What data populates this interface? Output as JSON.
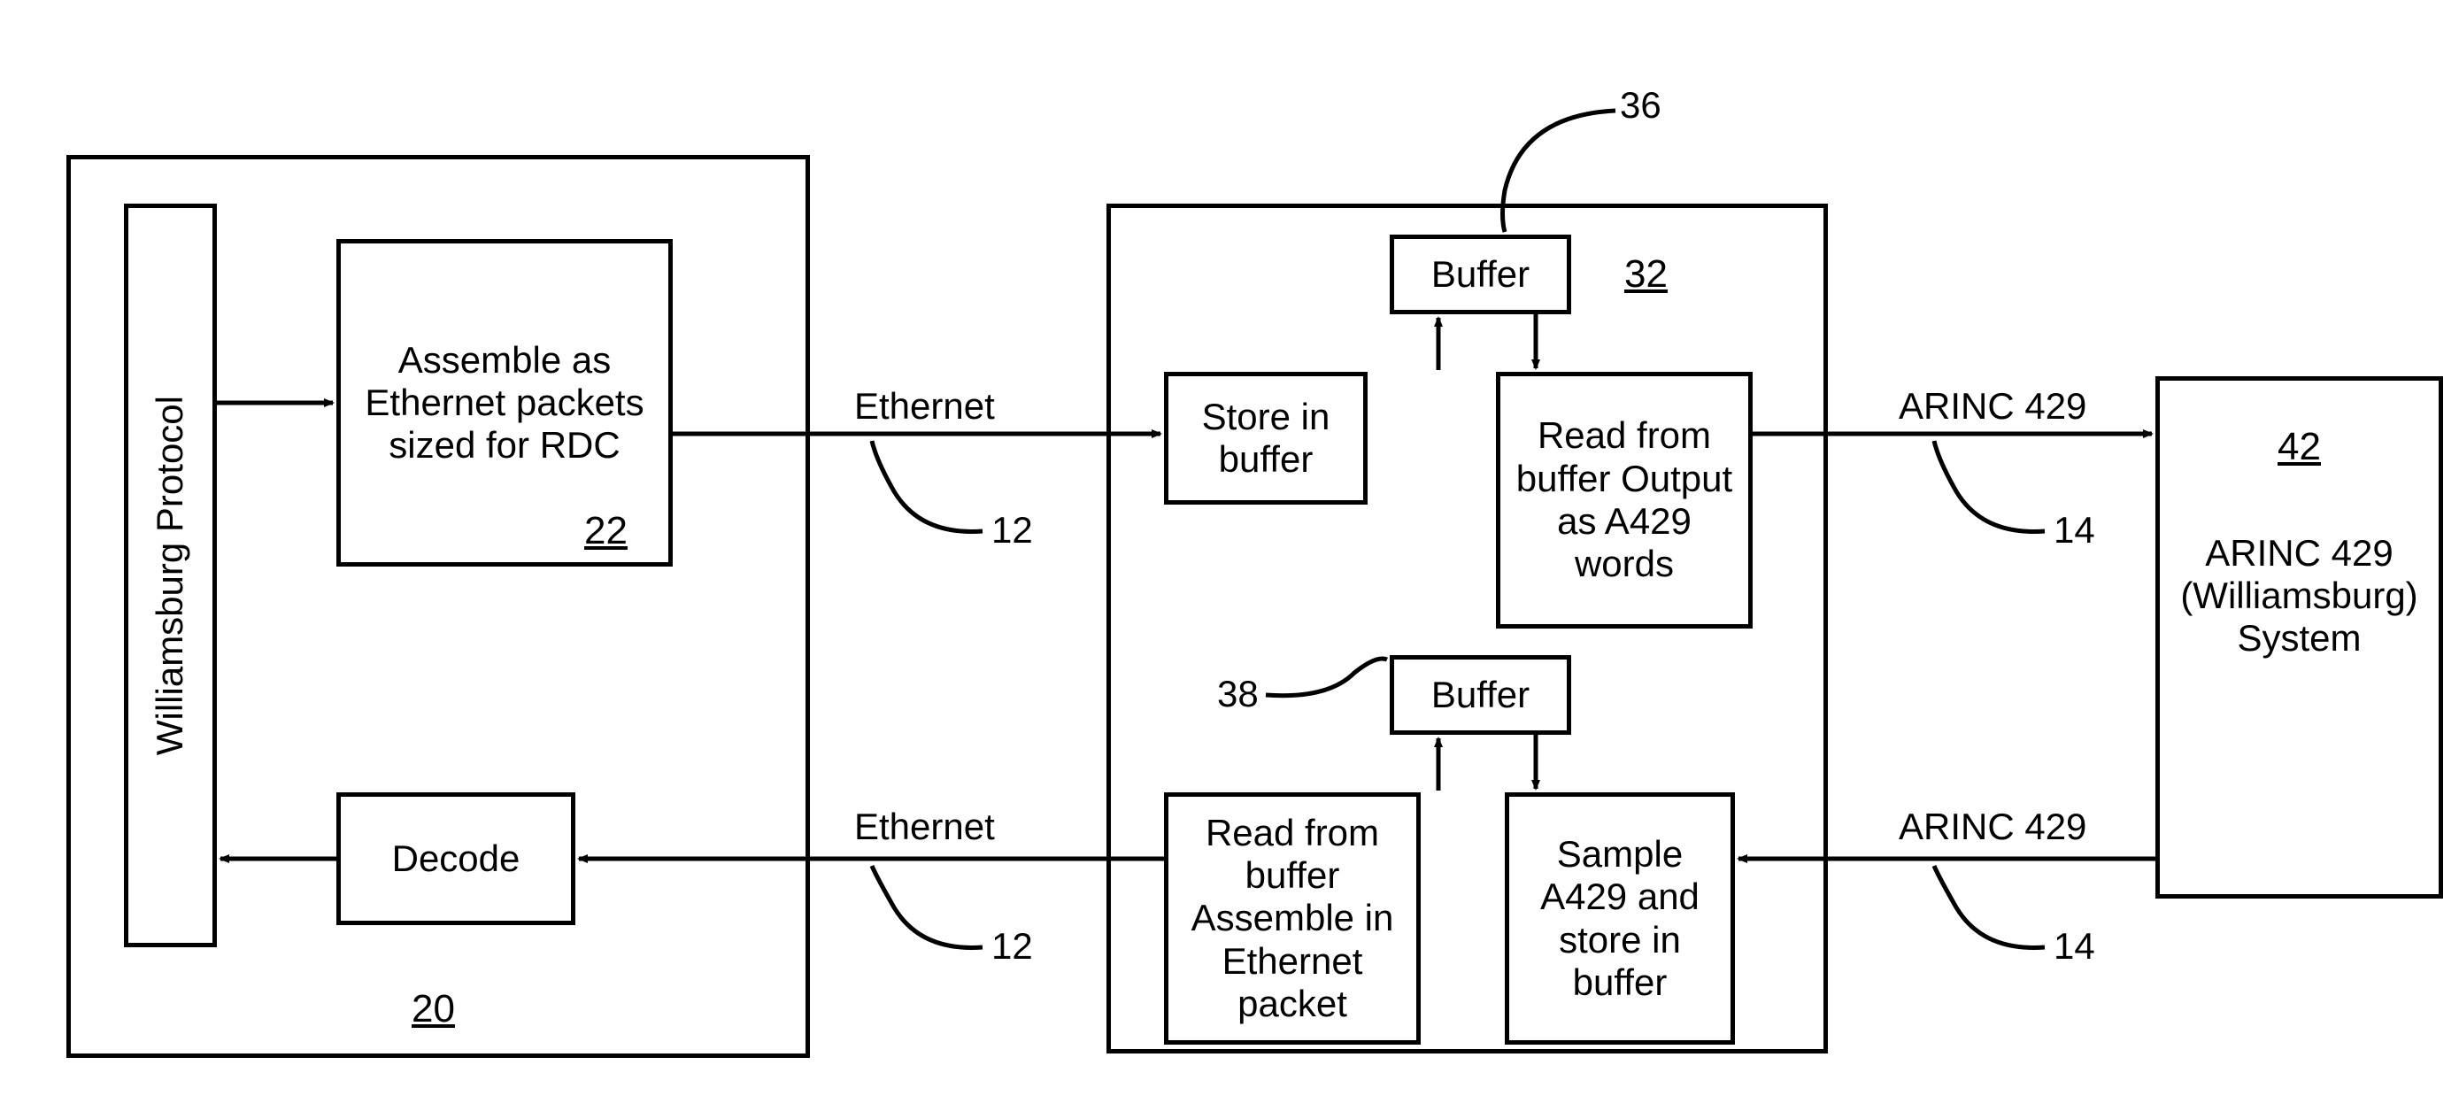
{
  "block20": {
    "ref": "20",
    "protocol": "Williamsburg Protocol",
    "assemble": "Assemble as Ethernet packets sized for RDC",
    "assemble_ref": "22",
    "decode": "Decode"
  },
  "block32": {
    "ref": "32",
    "buffer_top": "Buffer",
    "buffer_top_ref": "36",
    "store_in_buffer": "Store in buffer",
    "read_output": "Read from buffer Output as A429 words",
    "buffer_bottom": "Buffer",
    "buffer_bottom_ref": "38",
    "read_assemble": "Read from buffer Assemble in Ethernet packet",
    "sample": "Sample A429 and store in buffer"
  },
  "block42": {
    "ref": "42",
    "title": "ARINC 429 (Williamsburg) System"
  },
  "links": {
    "ethernet_top": "Ethernet",
    "ethernet_top_ref": "12",
    "ethernet_bottom": "Ethernet",
    "ethernet_bottom_ref": "12",
    "arinc_top": "ARINC 429",
    "arinc_top_ref": "14",
    "arinc_bottom": "ARINC 429",
    "arinc_bottom_ref": "14"
  }
}
